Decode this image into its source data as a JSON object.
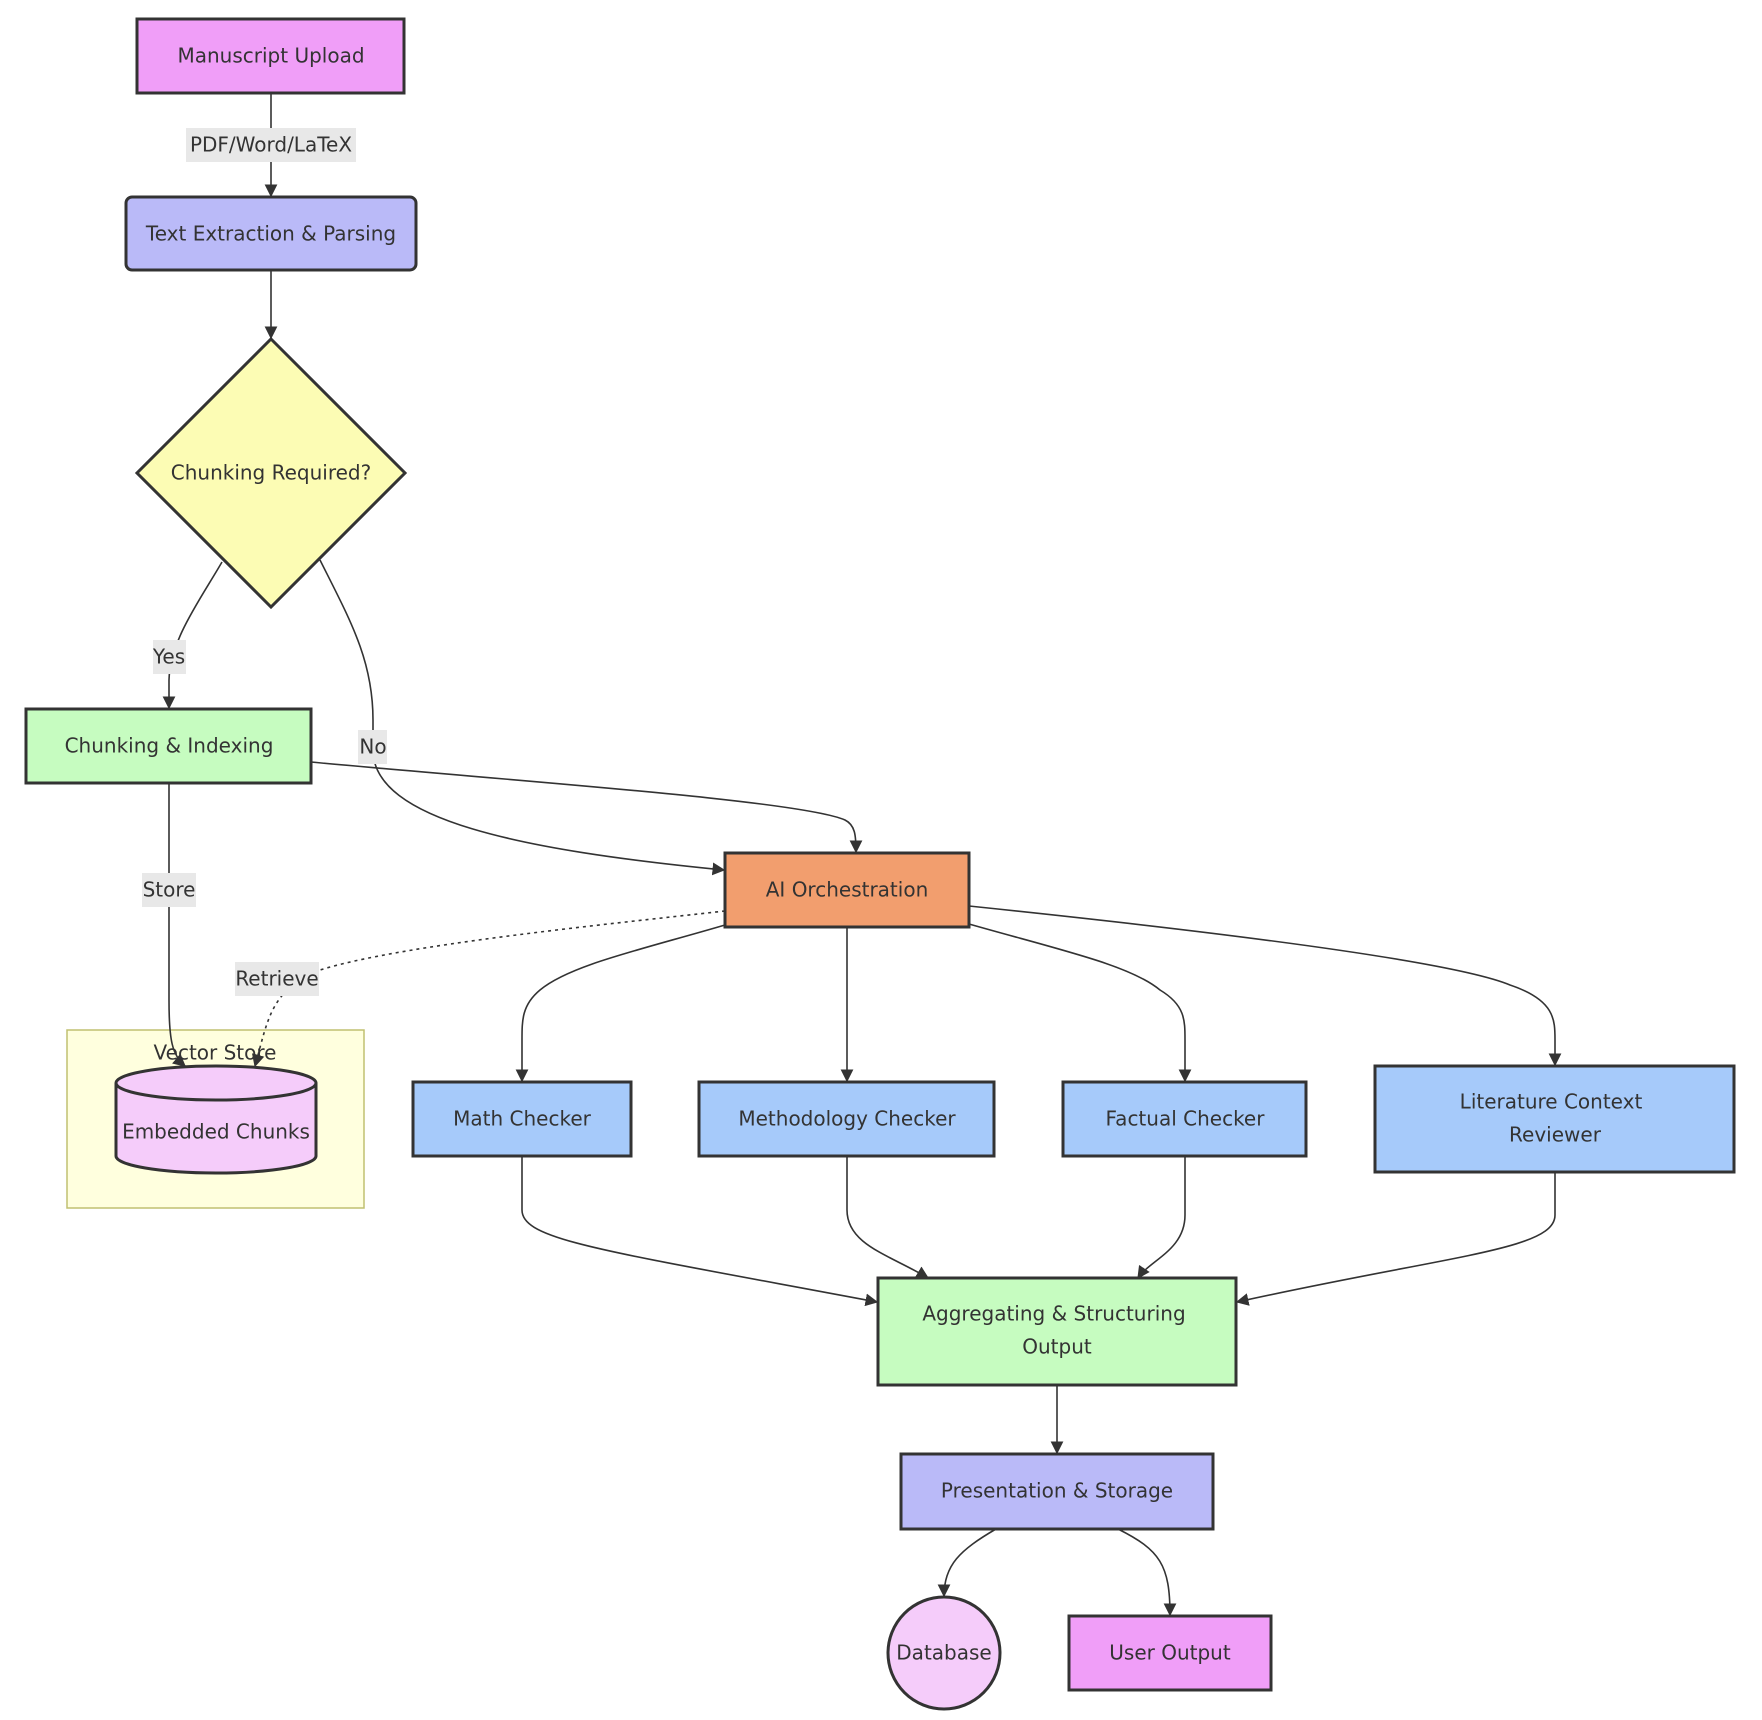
{
  "diagram": {
    "type": "flowchart",
    "colors": {
      "input": "#f09ef8",
      "process_purple": "#babaf8",
      "decision": "#fcfcb4",
      "process_green": "#c6fcc0",
      "orchestration": "#f29e6e",
      "checker": "#a6cafa",
      "storage": "#f5ccfa",
      "cluster_fill": "#ffffde",
      "stroke": "#333333",
      "edge_label_bg": "#e8e8e8"
    },
    "nodes": [
      {
        "id": "upload",
        "label": "Manuscript Upload",
        "shape": "rect",
        "color": "input"
      },
      {
        "id": "extract",
        "label": "Text Extraction & Parsing",
        "shape": "round-rect",
        "color": "process_purple"
      },
      {
        "id": "decision",
        "label": "Chunking Required?",
        "shape": "diamond",
        "color": "decision"
      },
      {
        "id": "chunk",
        "label": "Chunking & Indexing",
        "shape": "rect",
        "color": "process_green"
      },
      {
        "id": "orch",
        "label": "AI Orchestration",
        "shape": "rect",
        "color": "orchestration"
      },
      {
        "id": "embedded",
        "label": "Embedded Chunks",
        "shape": "cylinder",
        "color": "storage"
      },
      {
        "id": "math",
        "label": "Math Checker",
        "shape": "rect",
        "color": "checker"
      },
      {
        "id": "method",
        "label": "Methodology Checker",
        "shape": "rect",
        "color": "checker"
      },
      {
        "id": "fact",
        "label": "Factual Checker",
        "shape": "rect",
        "color": "checker"
      },
      {
        "id": "lit",
        "label": [
          "Literature Context",
          "Reviewer"
        ],
        "shape": "rect",
        "color": "checker"
      },
      {
        "id": "agg",
        "label": [
          "Aggregating & Structuring",
          "Output"
        ],
        "shape": "rect",
        "color": "process_green"
      },
      {
        "id": "present",
        "label": "Presentation & Storage",
        "shape": "rect",
        "color": "process_purple"
      },
      {
        "id": "db",
        "label": "Database",
        "shape": "circle",
        "color": "storage"
      },
      {
        "id": "user",
        "label": "User Output",
        "shape": "rect",
        "color": "input"
      }
    ],
    "clusters": [
      {
        "id": "vector-store",
        "label": "Vector Store",
        "contains": [
          "embedded"
        ]
      }
    ],
    "edges": [
      {
        "from": "upload",
        "to": "extract",
        "label": "PDF/Word/LaTeX",
        "style": "solid"
      },
      {
        "from": "extract",
        "to": "decision",
        "label": "",
        "style": "solid"
      },
      {
        "from": "decision",
        "to": "chunk",
        "label": "Yes",
        "style": "solid"
      },
      {
        "from": "decision",
        "to": "orch",
        "label": "No",
        "style": "solid"
      },
      {
        "from": "chunk",
        "to": "orch",
        "label": "",
        "style": "solid"
      },
      {
        "from": "chunk",
        "to": "embedded",
        "label": "Store",
        "style": "solid"
      },
      {
        "from": "orch",
        "to": "embedded",
        "label": "Retrieve",
        "style": "dotted"
      },
      {
        "from": "orch",
        "to": "math",
        "label": "",
        "style": "solid"
      },
      {
        "from": "orch",
        "to": "method",
        "label": "",
        "style": "solid"
      },
      {
        "from": "orch",
        "to": "fact",
        "label": "",
        "style": "solid"
      },
      {
        "from": "orch",
        "to": "lit",
        "label": "",
        "style": "solid"
      },
      {
        "from": "math",
        "to": "agg",
        "label": "",
        "style": "solid"
      },
      {
        "from": "method",
        "to": "agg",
        "label": "",
        "style": "solid"
      },
      {
        "from": "fact",
        "to": "agg",
        "label": "",
        "style": "solid"
      },
      {
        "from": "lit",
        "to": "agg",
        "label": "",
        "style": "solid"
      },
      {
        "from": "agg",
        "to": "present",
        "label": "",
        "style": "solid"
      },
      {
        "from": "present",
        "to": "db",
        "label": "",
        "style": "solid"
      },
      {
        "from": "present",
        "to": "user",
        "label": "",
        "style": "solid"
      }
    ]
  }
}
